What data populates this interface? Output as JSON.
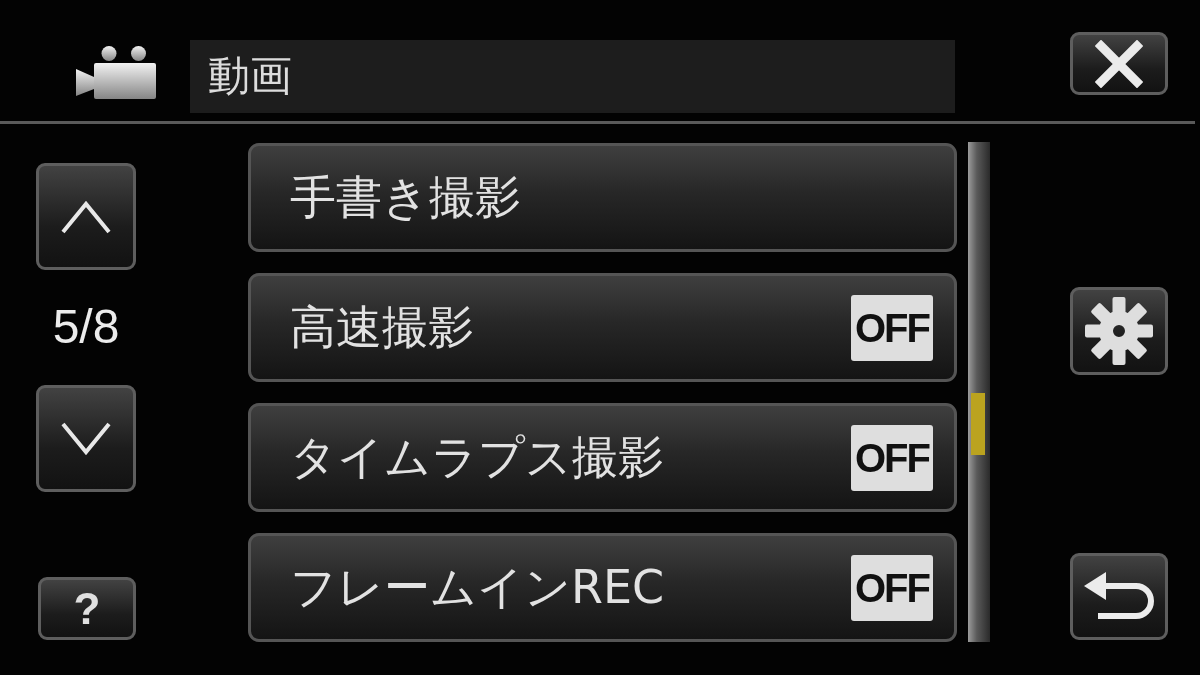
{
  "header": {
    "title": "動画"
  },
  "pager": {
    "page": "5/8"
  },
  "help_button": {
    "label": "?"
  },
  "menu_items": [
    {
      "kind": "command",
      "label": "手書き撮影"
    },
    {
      "kind": "setting",
      "label": "高速撮影",
      "value": "OFF"
    },
    {
      "kind": "setting",
      "label": "タイムラプス撮影",
      "value": "OFF"
    },
    {
      "kind": "setting",
      "label": "フレームインREC",
      "value": "OFF"
    }
  ]
}
